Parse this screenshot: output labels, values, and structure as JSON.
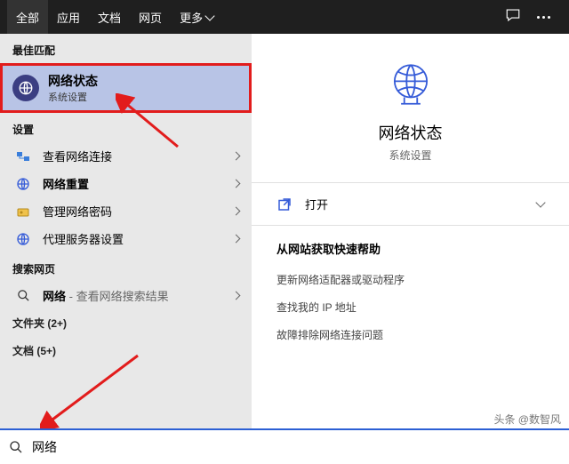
{
  "header": {
    "tabs": {
      "all": "全部",
      "apps": "应用",
      "docs": "文档",
      "web": "网页",
      "more": "更多"
    }
  },
  "left": {
    "best_match_label": "最佳匹配",
    "best_match": {
      "title": "网络状态",
      "subtitle": "系统设置"
    },
    "settings_label": "设置",
    "items": {
      "view_connections": "查看网络连接",
      "network_reset": "网络重置",
      "manage_passwords": "管理网络密码",
      "proxy_settings": "代理服务器设置"
    },
    "search_web_label": "搜索网页",
    "search_web_item": {
      "term": "网络",
      "suffix": " - 查看网络搜索结果"
    },
    "folders_label": "文件夹 (2+)",
    "docs_label": "文档 (5+)"
  },
  "right": {
    "title": "网络状态",
    "subtitle": "系统设置",
    "open_label": "打开",
    "help_header": "从网站获取快速帮助",
    "help_links": {
      "update_driver": "更新网络适配器或驱动程序",
      "find_ip": "查找我的 IP 地址",
      "troubleshoot": "故障排除网络连接问题"
    }
  },
  "search": {
    "value": "网络"
  },
  "watermark": "头条 @数智风"
}
